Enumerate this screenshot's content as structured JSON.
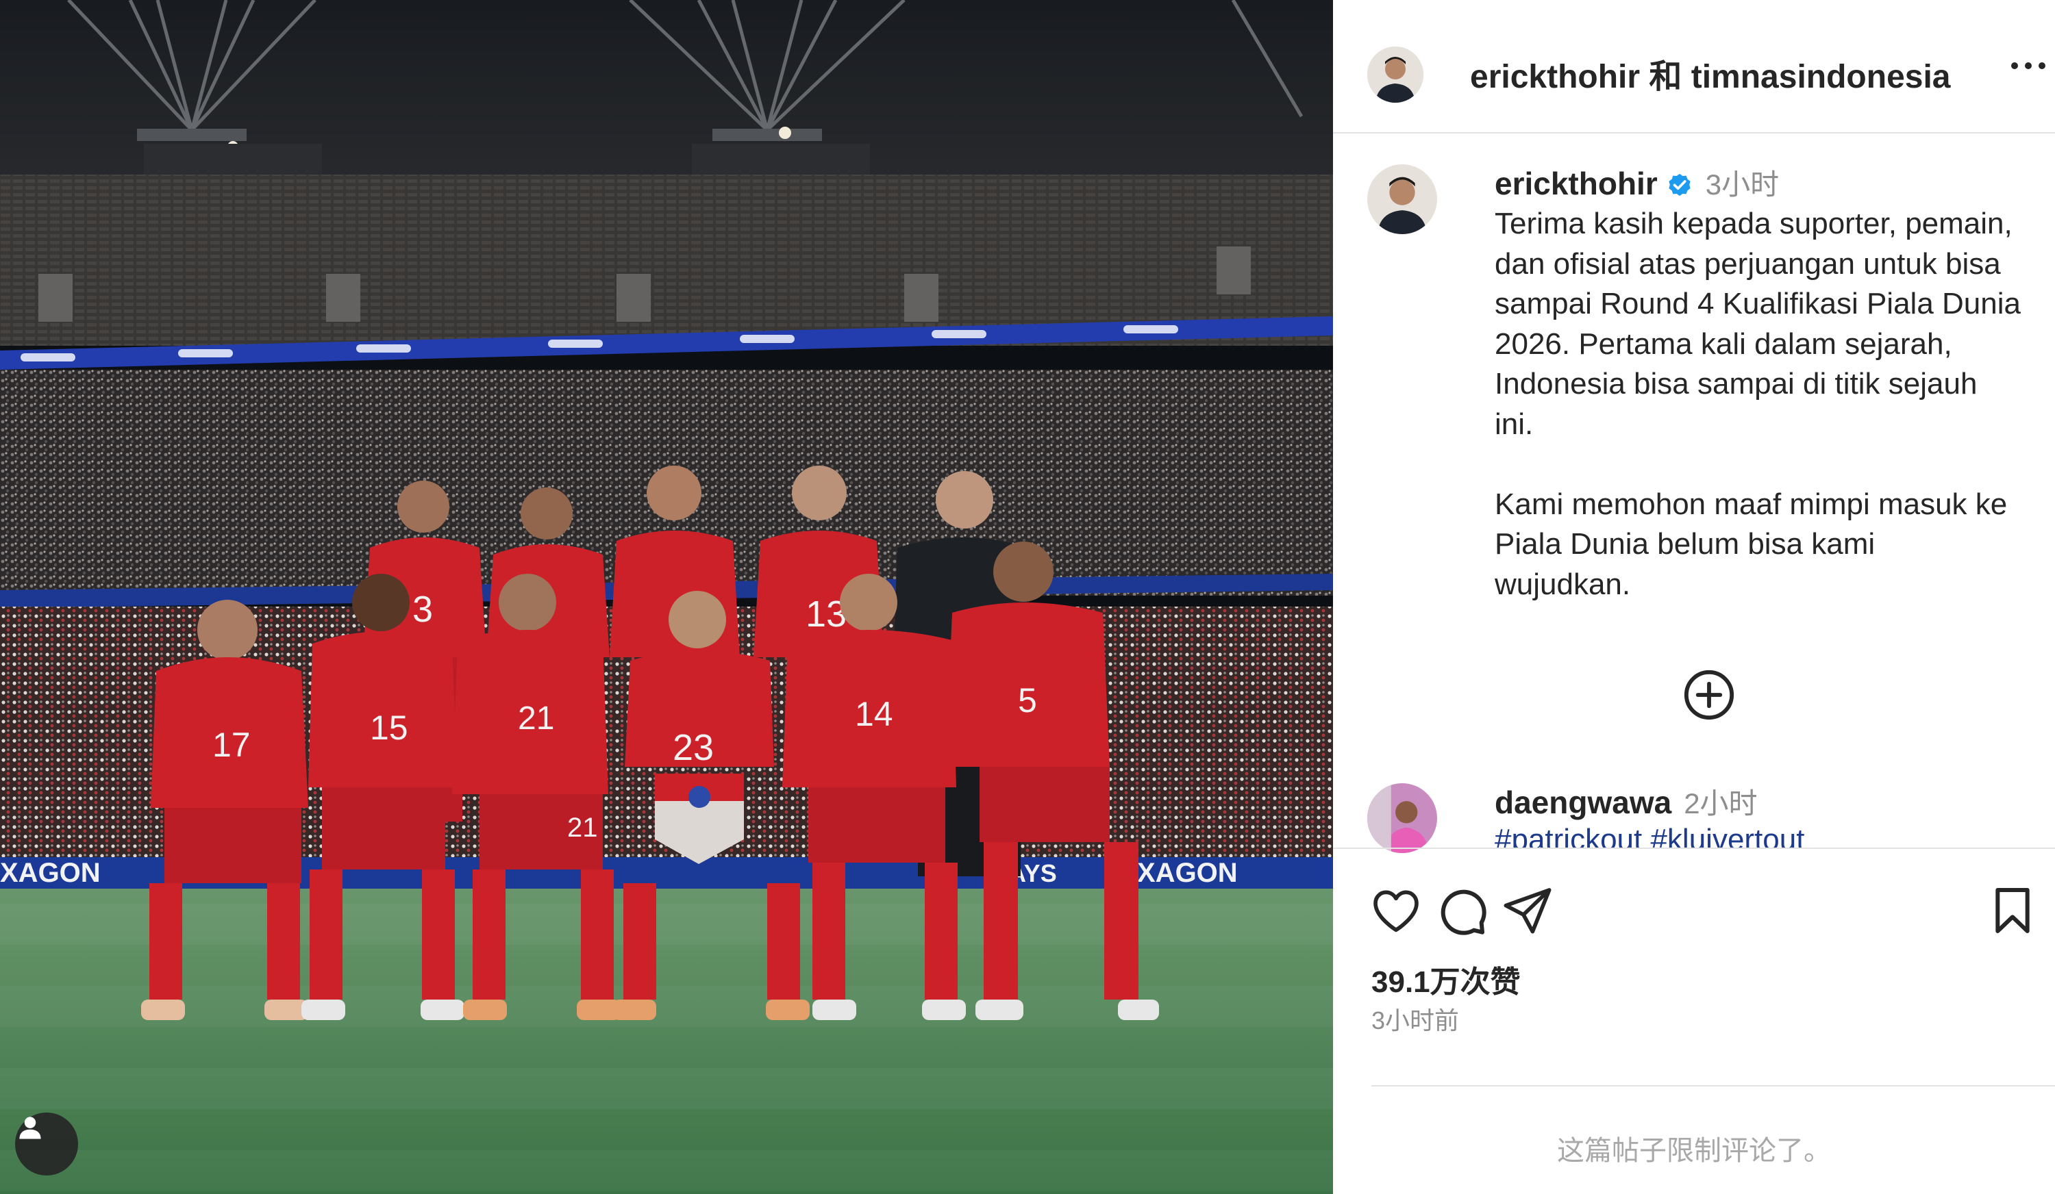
{
  "post_header": {
    "title": "erickthohir 和 timnasindonesia",
    "more_icon": "more-horizontal-icon"
  },
  "caption": {
    "author": "erickthohir",
    "verified": true,
    "time": "3小时",
    "text": "Terima kasih kepada suporter, pemain,\ndan ofisial atas perjuangan untuk bisa\nsampai Round 4 Kualifikasi Piala Dunia\n2026. Pertama kali dalam sejarah,\nIndonesia bisa sampai di titik sejauh\nini.\n\nKami memohon maaf mimpi masuk ke\nPiala Dunia belum bisa kami\nwujudkan."
  },
  "load_more_icon": "plus-circle-icon",
  "reply": {
    "author": "daengwawa",
    "time": "2小时",
    "hashtags": "#patrickout #kluivertout"
  },
  "actions": {
    "like_icon": "heart-icon",
    "comment_icon": "comment-icon",
    "share_icon": "send-icon",
    "save_icon": "bookmark-icon"
  },
  "likes": "39.1万次赞",
  "posted_time": "3小时前",
  "comments_limited": "这篇帖子限制评论了。",
  "photo": {
    "tagged_icon": "user-icon",
    "ad_board": "OXAGON"
  },
  "colors": {
    "kit_red": "#d9232d",
    "pitch_green": "#4f8a57",
    "hashtag_blue": "#1e3a8a",
    "verified_blue": "#1d9bf0"
  }
}
